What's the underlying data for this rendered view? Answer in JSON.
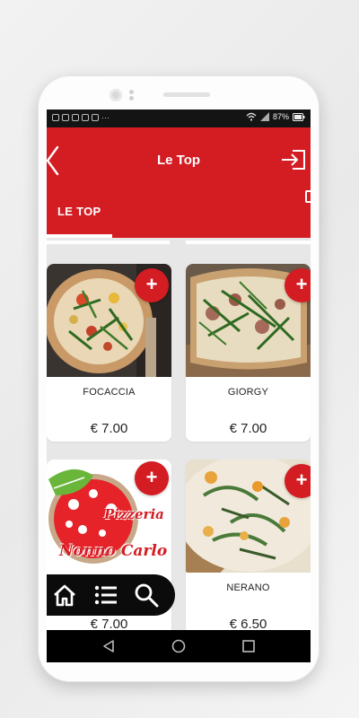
{
  "status_bar": {
    "battery": "87%"
  },
  "app_bar": {
    "title": "Le Top"
  },
  "tabs": [
    {
      "label": "LE TOP",
      "selected": true
    }
  ],
  "products": [
    {
      "name": "FOCACCIA",
      "price": "€ 7.00",
      "add_label": "+",
      "image": "pizza-focaccia"
    },
    {
      "name": "GIORGY",
      "price": "€ 7.00",
      "add_label": "+",
      "image": "pizza-giorgy"
    },
    {
      "name": "",
      "price": "€ 7.00",
      "add_label": "+",
      "image": "pizzeria-logo",
      "logo_text": [
        "Pizzeria",
        "Nonno Carlo"
      ]
    },
    {
      "name": "NERANO",
      "price": "€ 6.50",
      "add_label": "+",
      "image": "pizza-nerano"
    }
  ],
  "bottom_nav": [
    "home-icon",
    "list-icon",
    "search-icon"
  ],
  "colors": {
    "primary": "#d41c23",
    "background": "#e7e7e7",
    "dark": "#0b0b0b"
  }
}
